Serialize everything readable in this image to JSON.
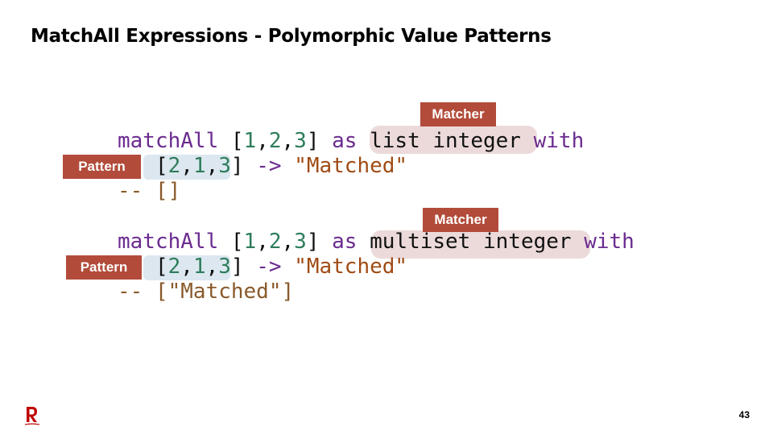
{
  "slide": {
    "title": "MatchAll Expressions - Polymorphic Value Patterns",
    "page_number": "43",
    "logo_icon": "rakuten-r-logo",
    "accent_color": "#b24b3a"
  },
  "example1": {
    "matcher_label": "Matcher",
    "pattern_label": "Pattern",
    "line1": {
      "kw_matchall": "matchAll",
      "open": "[",
      "n1": "1",
      "c1": ",",
      "n2": "2",
      "c2": ",",
      "n3": "3",
      "close": "]",
      "kw_as": "as",
      "matcher": "list integer",
      "kw_with": "with"
    },
    "line2": {
      "open": "[",
      "n1": "2",
      "c1": ",",
      "n2": "1",
      "c2": ",",
      "n3": "3",
      "close": "]",
      "arrow": "->",
      "result": "\"Matched\""
    },
    "line3": {
      "comment": "-- []"
    }
  },
  "example2": {
    "matcher_label": "Matcher",
    "pattern_label": "Pattern",
    "line1": {
      "kw_matchall": "matchAll",
      "open": "[",
      "n1": "1",
      "c1": ",",
      "n2": "2",
      "c2": ",",
      "n3": "3",
      "close": "]",
      "kw_as": "as",
      "matcher": "multiset integer",
      "kw_with": "with"
    },
    "line2": {
      "open": "[",
      "n1": "2",
      "c1": ",",
      "n2": "1",
      "c2": ",",
      "n3": "3",
      "close": "]",
      "arrow": "->",
      "result": "\"Matched\""
    },
    "line3": {
      "comment": "-- [\"Matched\"]"
    }
  }
}
